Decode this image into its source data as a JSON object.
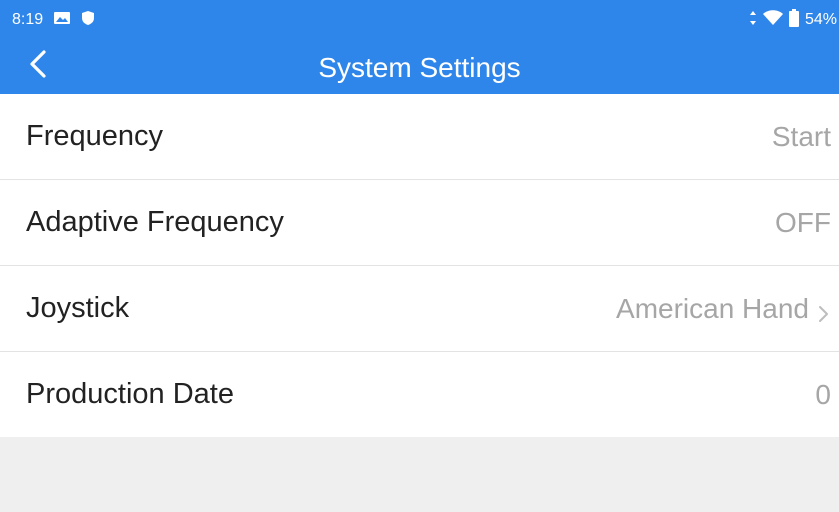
{
  "status_bar": {
    "time": "8:19",
    "battery": "54%",
    "icons": [
      "image-icon",
      "shield-icon",
      "data-arrows-icon",
      "wifi-icon",
      "battery-icon"
    ],
    "bg_color": "#2f86ea"
  },
  "app_bar": {
    "title": "System Settings",
    "back_icon": "chevron-left-icon"
  },
  "settings": [
    {
      "label": "Frequency",
      "value": "Start"
    },
    {
      "label": "Adaptive Frequency",
      "value": "OFF"
    },
    {
      "label": "Joystick",
      "value": "American Hand"
    },
    {
      "label": "Production Date",
      "value": "0"
    }
  ]
}
